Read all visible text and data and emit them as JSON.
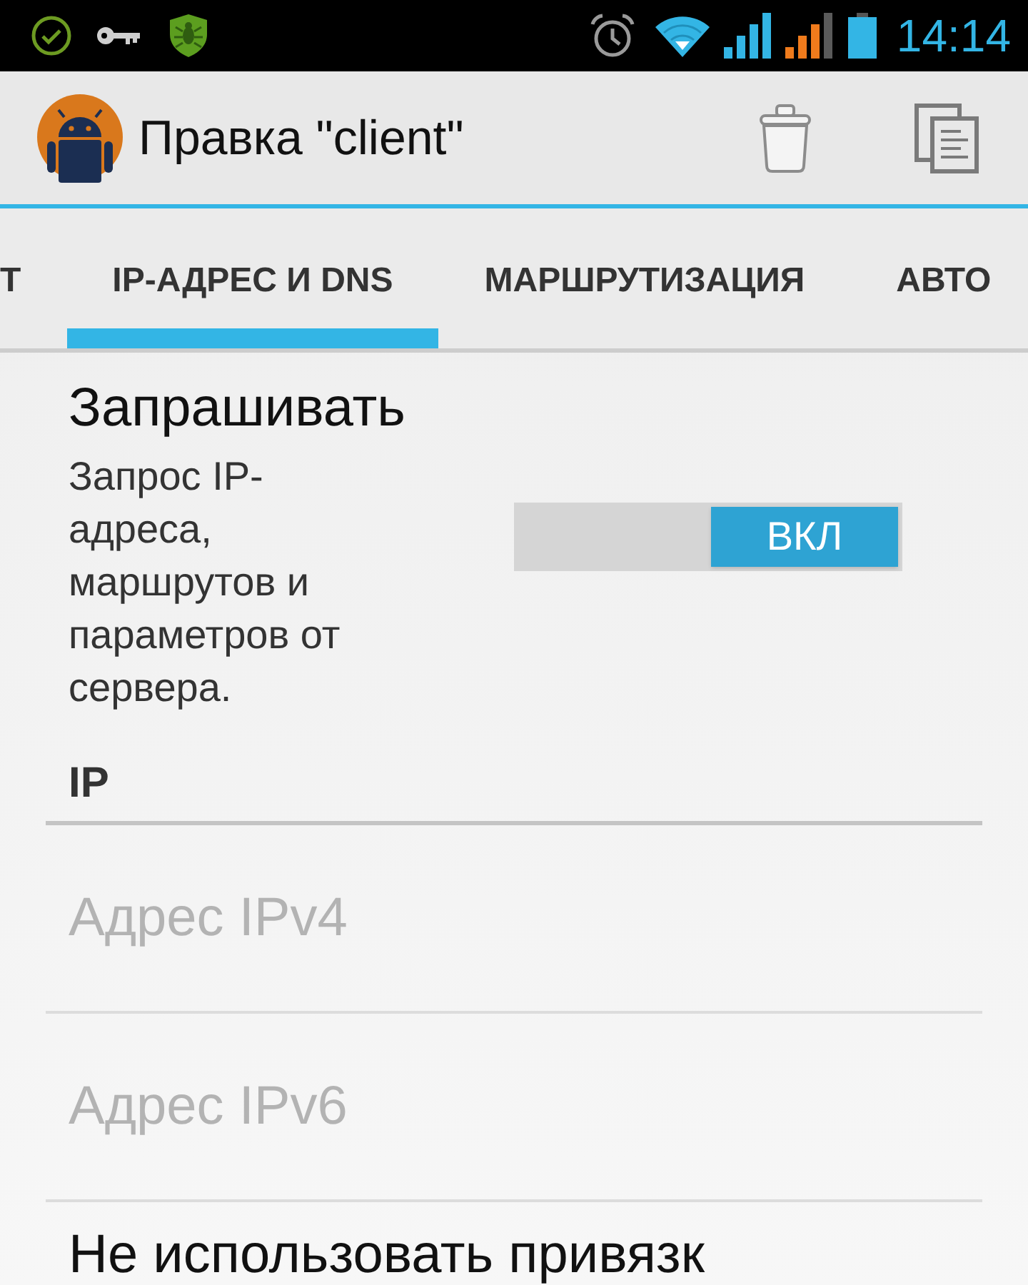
{
  "status_bar": {
    "time": "14:14"
  },
  "action_bar": {
    "title": "Правка \"client\""
  },
  "tabs": [
    {
      "label": "Т",
      "selected": false
    },
    {
      "label": "IP-АДРЕС И DNS",
      "selected": true
    },
    {
      "label": "МАРШРУТИЗАЦИЯ",
      "selected": false
    },
    {
      "label": "АВТО",
      "selected": false
    }
  ],
  "items": [
    {
      "kind": "switch",
      "title": "Запрашивать",
      "summary": "Запрос IP-адреса, маршрутов и параметров от сервера.",
      "on": true,
      "switch_label": "ВКЛ"
    },
    {
      "kind": "header",
      "title": "IP"
    },
    {
      "kind": "field",
      "placeholder": "Адрес IPv4"
    },
    {
      "kind": "field",
      "placeholder": "Адрес IPv6"
    },
    {
      "kind": "option",
      "title": "Не использовать привязк"
    }
  ]
}
